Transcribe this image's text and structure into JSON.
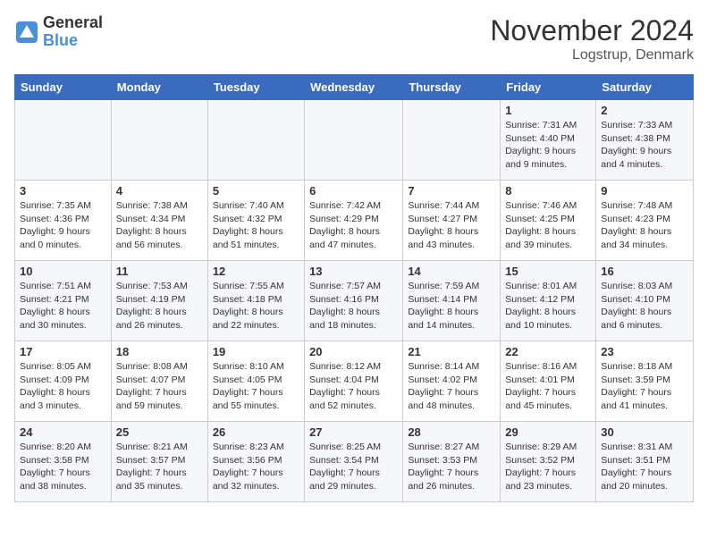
{
  "logo": {
    "general": "General",
    "blue": "Blue"
  },
  "title": "November 2024",
  "location": "Logstrup, Denmark",
  "days_header": [
    "Sunday",
    "Monday",
    "Tuesday",
    "Wednesday",
    "Thursday",
    "Friday",
    "Saturday"
  ],
  "weeks": [
    [
      {
        "day": "",
        "info": ""
      },
      {
        "day": "",
        "info": ""
      },
      {
        "day": "",
        "info": ""
      },
      {
        "day": "",
        "info": ""
      },
      {
        "day": "",
        "info": ""
      },
      {
        "day": "1",
        "info": "Sunrise: 7:31 AM\nSunset: 4:40 PM\nDaylight: 9 hours\nand 9 minutes."
      },
      {
        "day": "2",
        "info": "Sunrise: 7:33 AM\nSunset: 4:38 PM\nDaylight: 9 hours\nand 4 minutes."
      }
    ],
    [
      {
        "day": "3",
        "info": "Sunrise: 7:35 AM\nSunset: 4:36 PM\nDaylight: 9 hours\nand 0 minutes."
      },
      {
        "day": "4",
        "info": "Sunrise: 7:38 AM\nSunset: 4:34 PM\nDaylight: 8 hours\nand 56 minutes."
      },
      {
        "day": "5",
        "info": "Sunrise: 7:40 AM\nSunset: 4:32 PM\nDaylight: 8 hours\nand 51 minutes."
      },
      {
        "day": "6",
        "info": "Sunrise: 7:42 AM\nSunset: 4:29 PM\nDaylight: 8 hours\nand 47 minutes."
      },
      {
        "day": "7",
        "info": "Sunrise: 7:44 AM\nSunset: 4:27 PM\nDaylight: 8 hours\nand 43 minutes."
      },
      {
        "day": "8",
        "info": "Sunrise: 7:46 AM\nSunset: 4:25 PM\nDaylight: 8 hours\nand 39 minutes."
      },
      {
        "day": "9",
        "info": "Sunrise: 7:48 AM\nSunset: 4:23 PM\nDaylight: 8 hours\nand 34 minutes."
      }
    ],
    [
      {
        "day": "10",
        "info": "Sunrise: 7:51 AM\nSunset: 4:21 PM\nDaylight: 8 hours\nand 30 minutes."
      },
      {
        "day": "11",
        "info": "Sunrise: 7:53 AM\nSunset: 4:19 PM\nDaylight: 8 hours\nand 26 minutes."
      },
      {
        "day": "12",
        "info": "Sunrise: 7:55 AM\nSunset: 4:18 PM\nDaylight: 8 hours\nand 22 minutes."
      },
      {
        "day": "13",
        "info": "Sunrise: 7:57 AM\nSunset: 4:16 PM\nDaylight: 8 hours\nand 18 minutes."
      },
      {
        "day": "14",
        "info": "Sunrise: 7:59 AM\nSunset: 4:14 PM\nDaylight: 8 hours\nand 14 minutes."
      },
      {
        "day": "15",
        "info": "Sunrise: 8:01 AM\nSunset: 4:12 PM\nDaylight: 8 hours\nand 10 minutes."
      },
      {
        "day": "16",
        "info": "Sunrise: 8:03 AM\nSunset: 4:10 PM\nDaylight: 8 hours\nand 6 minutes."
      }
    ],
    [
      {
        "day": "17",
        "info": "Sunrise: 8:05 AM\nSunset: 4:09 PM\nDaylight: 8 hours\nand 3 minutes."
      },
      {
        "day": "18",
        "info": "Sunrise: 8:08 AM\nSunset: 4:07 PM\nDaylight: 7 hours\nand 59 minutes."
      },
      {
        "day": "19",
        "info": "Sunrise: 8:10 AM\nSunset: 4:05 PM\nDaylight: 7 hours\nand 55 minutes."
      },
      {
        "day": "20",
        "info": "Sunrise: 8:12 AM\nSunset: 4:04 PM\nDaylight: 7 hours\nand 52 minutes."
      },
      {
        "day": "21",
        "info": "Sunrise: 8:14 AM\nSunset: 4:02 PM\nDaylight: 7 hours\nand 48 minutes."
      },
      {
        "day": "22",
        "info": "Sunrise: 8:16 AM\nSunset: 4:01 PM\nDaylight: 7 hours\nand 45 minutes."
      },
      {
        "day": "23",
        "info": "Sunrise: 8:18 AM\nSunset: 3:59 PM\nDaylight: 7 hours\nand 41 minutes."
      }
    ],
    [
      {
        "day": "24",
        "info": "Sunrise: 8:20 AM\nSunset: 3:58 PM\nDaylight: 7 hours\nand 38 minutes."
      },
      {
        "day": "25",
        "info": "Sunrise: 8:21 AM\nSunset: 3:57 PM\nDaylight: 7 hours\nand 35 minutes."
      },
      {
        "day": "26",
        "info": "Sunrise: 8:23 AM\nSunset: 3:56 PM\nDaylight: 7 hours\nand 32 minutes."
      },
      {
        "day": "27",
        "info": "Sunrise: 8:25 AM\nSunset: 3:54 PM\nDaylight: 7 hours\nand 29 minutes."
      },
      {
        "day": "28",
        "info": "Sunrise: 8:27 AM\nSunset: 3:53 PM\nDaylight: 7 hours\nand 26 minutes."
      },
      {
        "day": "29",
        "info": "Sunrise: 8:29 AM\nSunset: 3:52 PM\nDaylight: 7 hours\nand 23 minutes."
      },
      {
        "day": "30",
        "info": "Sunrise: 8:31 AM\nSunset: 3:51 PM\nDaylight: 7 hours\nand 20 minutes."
      }
    ]
  ]
}
